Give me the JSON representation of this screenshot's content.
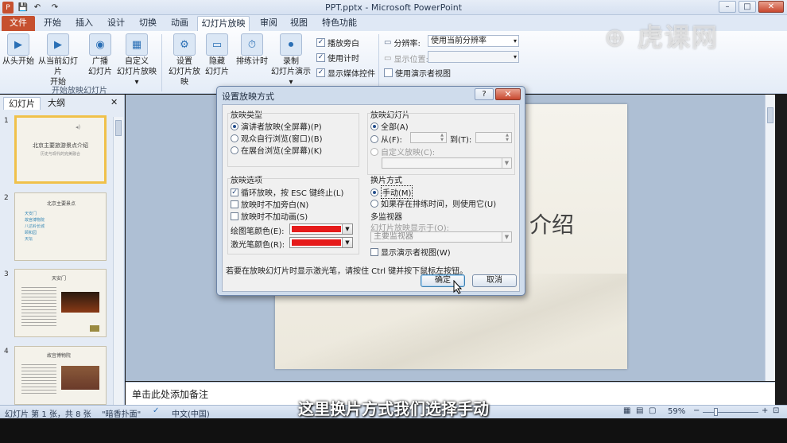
{
  "window": {
    "title": "PPT.pptx - Microsoft PowerPoint",
    "minimize": "–",
    "maximize": "□",
    "close": "✕"
  },
  "quick_access": {
    "save": "💾",
    "undo": "↶",
    "redo": "↷"
  },
  "tabs": [
    "文件",
    "开始",
    "插入",
    "设计",
    "切换",
    "动画",
    "幻灯片放映",
    "审阅",
    "视图",
    "特色功能"
  ],
  "active_tab_index": 6,
  "ribbon": {
    "start_group": {
      "buttons": [
        "从头开始",
        "从当前幻灯片开始",
        "广播幻灯片",
        "自定义幻灯片放映"
      ],
      "from_current_line1": "从当前幻灯片",
      "from_current_line2": "开始",
      "broadcast_line1": "广播",
      "broadcast_line2": "幻灯片",
      "custom_line1": "自定义",
      "custom_line2": "幻灯片放映 ▾",
      "label": "开始放映幻灯片"
    },
    "setup_group": {
      "setup_line1": "设置",
      "setup_line2": "幻灯片放映",
      "hide_line1": "隐藏",
      "hide_line2": "幻灯片",
      "rehearse": "排练计时",
      "record_line1": "录制",
      "record_line2": "幻灯片演示 ▾",
      "play_narration": "播放旁白",
      "use_timings": "使用计时",
      "show_media": "显示媒体控件"
    },
    "monitor_group": {
      "resolution_label": "分辨率:",
      "resolution_value": "使用当前分辨率",
      "show_on_label": "显示位置:",
      "presenter_view": "使用演示者视图"
    }
  },
  "left_panel": {
    "tab_slides": "幻灯片",
    "tab_outline": "大纲",
    "close": "✕",
    "slides": [
      {
        "num": "1",
        "title": "北京主要旅游景点介绍",
        "sub": "历史与现代的完美融合"
      },
      {
        "num": "2",
        "title": "北京主要景点",
        "bullets": [
          "天安门",
          "故宫博物院",
          "八达岭长城",
          "颐和园",
          "天坛"
        ]
      },
      {
        "num": "3",
        "title": "天安门"
      },
      {
        "num": "4",
        "title": "故宫博物院"
      }
    ]
  },
  "main_slide": {
    "title_fragment": "介绍"
  },
  "notes_placeholder": "单击此处添加备注",
  "status": {
    "slide_info": "幻灯片 第 1 张，共 8 张",
    "theme": "\"暗香扑面\"",
    "language": "中文(中国)",
    "zoom": "59%",
    "zoom_out": "−",
    "zoom_in": "+"
  },
  "dialog": {
    "title": "设置放映方式",
    "help": "?",
    "close": "✕",
    "show_type": {
      "label": "放映类型",
      "options": [
        "演讲者放映(全屏幕)(P)",
        "观众自行浏览(窗口)(B)",
        "在展台浏览(全屏幕)(K)"
      ],
      "selected": 0
    },
    "show_slides": {
      "label": "放映幻灯片",
      "all": "全部(A)",
      "from": "从(F):",
      "to": "到(T):",
      "custom": "自定义放映(C):"
    },
    "show_options": {
      "label": "放映选项",
      "loop": "循环放映，按 ESC 键终止(L)",
      "no_narration": "放映时不加旁白(N)",
      "no_animation": "放映时不加动画(S)",
      "pen_color_label": "绘图笔颜色(E):",
      "laser_color_label": "激光笔颜色(R):",
      "pen_color": "#e61b1b",
      "laser_color": "#e61b1b"
    },
    "advance": {
      "label": "换片方式",
      "manual": "手动(M)",
      "timings": "如果存在排练时间，则使用它(U)"
    },
    "multi_monitor": {
      "label": "多监视器",
      "show_on": "幻灯片放映显示于(O):",
      "monitor_value": "主要监视器",
      "presenter_view": "显示演示者视图(W)"
    },
    "hint": "若要在放映幻灯片时显示激光笔，请按住 Ctrl 键并按下鼠标左按钮。",
    "ok": "确定",
    "cancel": "取消"
  },
  "subtitle": "这里换片方式我们选择手动",
  "watermark": "虎课网"
}
